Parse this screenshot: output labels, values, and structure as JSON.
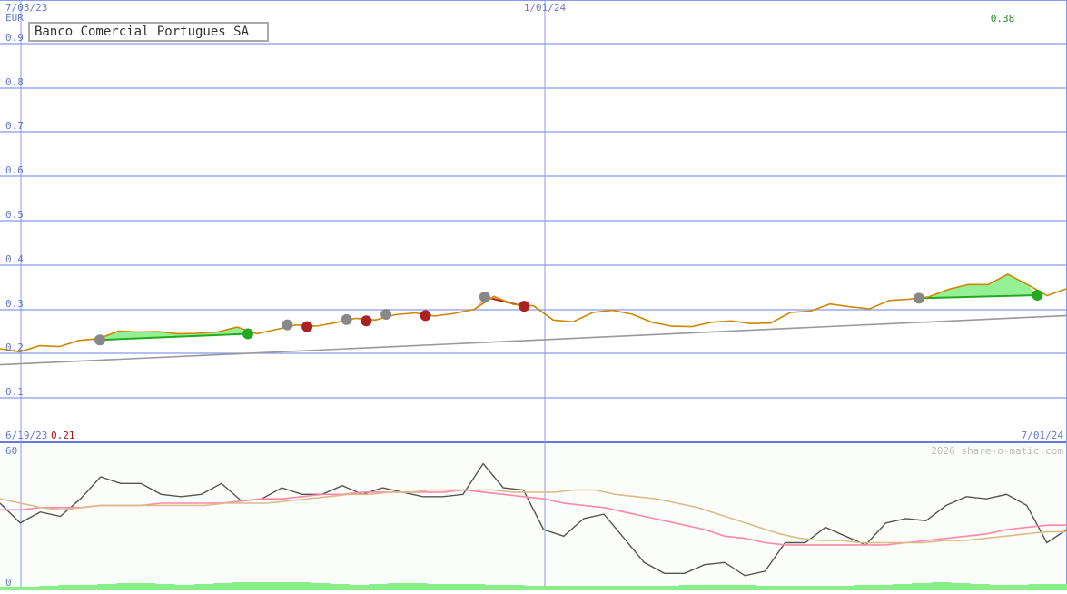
{
  "chart_data": [
    {
      "type": "line",
      "title": "Banco Comercial Portugues SA",
      "unit_label": "EUR",
      "date_labels": {
        "top_left": "7/03/23",
        "top_mid": "1/01/24",
        "bottom_left": "6/19/23",
        "bottom_right": "7/01/24"
      },
      "last_value_label": "0.38",
      "low_value_label": "0.21",
      "ylim": [
        0,
        1.0
      ],
      "yticks": [
        "0.1",
        "0.2",
        "0.3",
        "0.4",
        "0.5",
        "0.6",
        "0.7",
        "0.8",
        "0.9"
      ],
      "grid": true,
      "x_range_weeks": [
        0,
        53
      ],
      "series": [
        {
          "color": "#cc8800",
          "values": [
            0.211,
            0.204,
            0.218,
            0.216,
            0.23,
            0.234,
            0.251,
            0.249,
            0.25,
            0.245,
            0.246,
            0.249,
            0.26,
            0.245,
            0.255,
            0.265,
            0.262,
            0.27,
            0.28,
            0.276,
            0.288,
            0.292,
            0.285,
            0.291,
            0.3,
            0.329,
            0.311,
            0.308,
            0.276,
            0.272,
            0.293,
            0.298,
            0.289,
            0.271,
            0.262,
            0.261,
            0.271,
            0.274,
            0.268,
            0.269,
            0.293,
            0.296,
            0.312,
            0.306,
            0.301,
            0.32,
            0.323,
            0.328,
            0.345,
            0.356,
            0.356,
            0.379,
            0.356,
            0.331,
            0.347
          ]
        },
        {
          "color": "#999999",
          "values": [
            0.175,
            0.286
          ]
        }
      ],
      "signals": [
        {
          "type": "buy",
          "x_start": 4,
          "y_start": 0.231,
          "x_end": 11.5,
          "y_end": 0.245
        },
        {
          "type": "neutral",
          "x": 13.5,
          "y": 0.265
        },
        {
          "type": "sell",
          "x": 14.5,
          "y": 0.261
        },
        {
          "type": "neutral",
          "x": 16.5,
          "y": 0.277
        },
        {
          "type": "sell",
          "x": 17.5,
          "y": 0.274
        },
        {
          "type": "neutral",
          "x": 18.5,
          "y": 0.289
        },
        {
          "type": "sell",
          "x": 20.5,
          "y": 0.286
        },
        {
          "type": "sell",
          "x_start": 23.5,
          "y_start": 0.328,
          "x_end": 25.5,
          "y_end": 0.307
        },
        {
          "type": "buy",
          "x_start": 45.5,
          "y_start": 0.325,
          "x_end": 51.5,
          "y_end": 0.332
        }
      ]
    },
    {
      "type": "line",
      "title": "",
      "ylim": [
        0,
        60
      ],
      "yticks": [
        "60",
        "0"
      ],
      "credit": "2026 share-o-matic.com",
      "series": [
        {
          "color": "#555555",
          "values": [
            36,
            27,
            32,
            30,
            38,
            48,
            45,
            45,
            40,
            39,
            40,
            45,
            37,
            38,
            43,
            40,
            40,
            44,
            40,
            43,
            41,
            39,
            39,
            40,
            54,
            43,
            42,
            24,
            21,
            29,
            31,
            20,
            9,
            4,
            4,
            8,
            9,
            3,
            5,
            18,
            18,
            25,
            21,
            17,
            27,
            29,
            28,
            35,
            39,
            38,
            40,
            35,
            18,
            24
          ]
        },
        {
          "color": "#ff88aa",
          "values": [
            33,
            33,
            34,
            34,
            34,
            35,
            35,
            35,
            36,
            36,
            36,
            36,
            37,
            38,
            38,
            39,
            40,
            40,
            41,
            41,
            41,
            41,
            41,
            42,
            41,
            40,
            39,
            38,
            36,
            35,
            34,
            32,
            30,
            28,
            26,
            24,
            21,
            20,
            18,
            17,
            17,
            17,
            17,
            17,
            17,
            18,
            19,
            20,
            21,
            22,
            24,
            25,
            26,
            26
          ]
        },
        {
          "color": "#ddbb88",
          "values": [
            38,
            36,
            34,
            33,
            34,
            35,
            35,
            35,
            35,
            35,
            35,
            36,
            36,
            36,
            37,
            38,
            39,
            40,
            40,
            41,
            41,
            42,
            42,
            42,
            42,
            41,
            41,
            41,
            42,
            42,
            40,
            39,
            38,
            36,
            34,
            31,
            28,
            25,
            22,
            20,
            19,
            19,
            18,
            18,
            18,
            18,
            19,
            19,
            20,
            21,
            22,
            23,
            23
          ]
        }
      ],
      "volume": [
        4,
        4,
        5,
        6,
        6,
        7,
        8,
        8,
        7,
        6,
        7,
        8,
        9,
        9,
        9,
        9,
        8,
        7,
        6,
        7,
        8,
        8,
        7,
        7,
        7,
        6,
        6,
        5,
        5,
        5,
        5,
        5,
        5,
        5,
        5,
        6,
        6,
        6,
        6,
        5,
        5,
        5,
        5,
        5,
        6,
        6,
        7,
        8,
        9,
        8,
        7,
        6,
        6,
        7,
        7
      ]
    }
  ]
}
